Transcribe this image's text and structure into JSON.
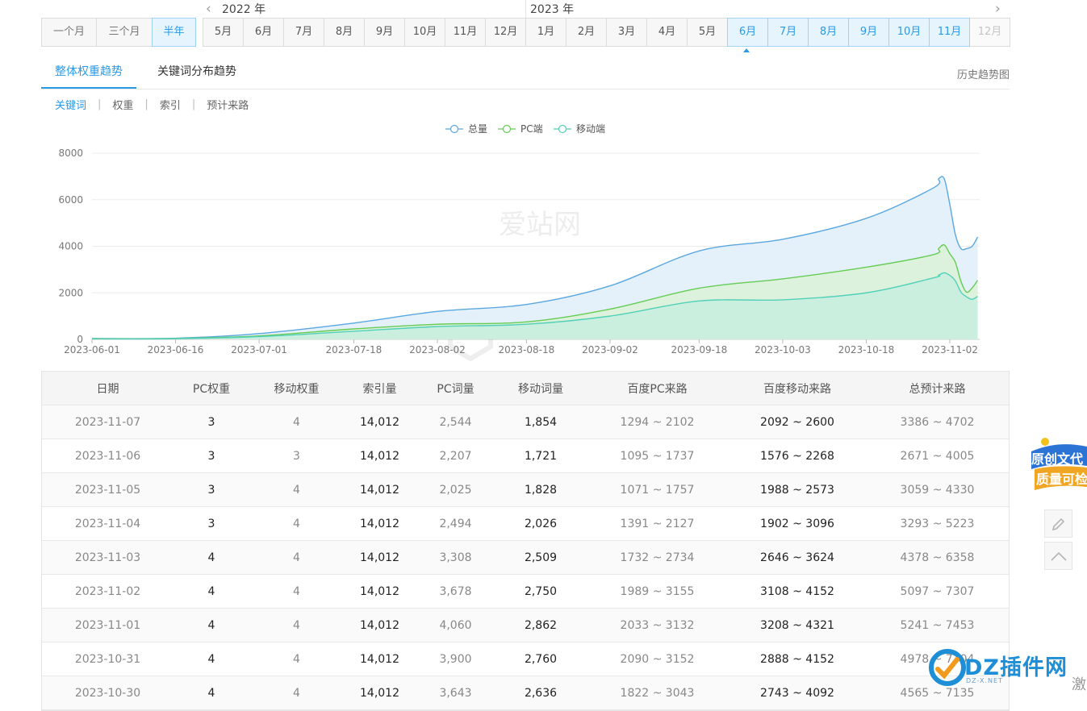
{
  "range_buttons": [
    {
      "label": "一个月",
      "active": false
    },
    {
      "label": "三个月",
      "active": false
    },
    {
      "label": "半年",
      "active": true
    }
  ],
  "timeline": {
    "year_left": "2022 年",
    "year_right": "2023 年",
    "months": [
      {
        "label": "5月",
        "state": "normal"
      },
      {
        "label": "6月",
        "state": "normal"
      },
      {
        "label": "7月",
        "state": "normal"
      },
      {
        "label": "8月",
        "state": "normal"
      },
      {
        "label": "9月",
        "state": "normal"
      },
      {
        "label": "10月",
        "state": "normal"
      },
      {
        "label": "11月",
        "state": "normal"
      },
      {
        "label": "12月",
        "state": "normal"
      },
      {
        "label": "1月",
        "state": "normal"
      },
      {
        "label": "2月",
        "state": "normal"
      },
      {
        "label": "3月",
        "state": "normal"
      },
      {
        "label": "4月",
        "state": "normal"
      },
      {
        "label": "5月",
        "state": "normal"
      },
      {
        "label": "6月",
        "state": "selected"
      },
      {
        "label": "7月",
        "state": "selected"
      },
      {
        "label": "8月",
        "state": "selected"
      },
      {
        "label": "9月",
        "state": "selected"
      },
      {
        "label": "10月",
        "state": "selected"
      },
      {
        "label": "11月",
        "state": "selected"
      },
      {
        "label": "12月",
        "state": "disabled"
      }
    ]
  },
  "tabs": {
    "main": "整体权重趋势",
    "keyword": "关键词分布趋势",
    "history": "历史趋势图"
  },
  "subnav": [
    "关键词",
    "权重",
    "索引",
    "预计来路"
  ],
  "watermark": "爱站网",
  "chart_data": {
    "type": "area",
    "legend_position": "top-center",
    "grid": true,
    "ylim": [
      0,
      8000
    ],
    "yticks": [
      0,
      2000,
      4000,
      6000,
      8000
    ],
    "xticks": [
      "2023-06-01",
      "2023-06-16",
      "2023-07-01",
      "2023-07-18",
      "2023-08-02",
      "2023-08-18",
      "2023-09-02",
      "2023-09-18",
      "2023-10-03",
      "2023-10-18",
      "2023-11-02"
    ],
    "x": [
      "2023-06-01",
      "2023-06-16",
      "2023-07-01",
      "2023-07-18",
      "2023-08-02",
      "2023-08-18",
      "2023-09-02",
      "2023-09-18",
      "2023-10-03",
      "2023-10-18",
      "2023-10-30",
      "2023-10-31",
      "2023-11-01",
      "2023-11-02",
      "2023-11-03",
      "2023-11-04",
      "2023-11-05",
      "2023-11-06",
      "2023-11-07"
    ],
    "series": [
      {
        "name": "总量",
        "color": "#5aa7e0",
        "fill": "#e1f0fb",
        "values": [
          40,
          50,
          250,
          700,
          1200,
          1500,
          2300,
          3800,
          4300,
          5200,
          6500,
          6900,
          6900,
          5800,
          4500,
          3900,
          3900,
          4000,
          4400
        ]
      },
      {
        "name": "PC端",
        "color": "#66cc55",
        "fill": "#dcf2d8",
        "values": [
          30,
          40,
          150,
          450,
          650,
          750,
          1300,
          2200,
          2600,
          3100,
          3640,
          3900,
          4060,
          3680,
          3310,
          2490,
          2030,
          2210,
          2540
        ]
      },
      {
        "name": "移动端",
        "color": "#52d0b8",
        "fill": "#c8eedf",
        "values": [
          20,
          30,
          120,
          350,
          550,
          650,
          1000,
          1650,
          1700,
          2000,
          2640,
          2760,
          2860,
          2750,
          2510,
          2030,
          1830,
          1720,
          1850
        ]
      }
    ]
  },
  "table": {
    "headers": [
      "日期",
      "PC权重",
      "移动权重",
      "索引量",
      "PC词量",
      "移动词量",
      "百度PC来路",
      "百度移动来路",
      "总预计来路"
    ],
    "rows": [
      [
        "2023-11-07",
        "3",
        "4",
        "14,012",
        "2,544",
        "1,854",
        "1294 ~ 2102",
        "2092 ~ 2600",
        "3386 ~ 4702"
      ],
      [
        "2023-11-06",
        "3",
        "3",
        "14,012",
        "2,207",
        "1,721",
        "1095 ~ 1737",
        "1576 ~ 2268",
        "2671 ~ 4005"
      ],
      [
        "2023-11-05",
        "3",
        "4",
        "14,012",
        "2,025",
        "1,828",
        "1071 ~ 1757",
        "1988 ~ 2573",
        "3059 ~ 4330"
      ],
      [
        "2023-11-04",
        "3",
        "4",
        "14,012",
        "2,494",
        "2,026",
        "1391 ~ 2127",
        "1902 ~ 3096",
        "3293 ~ 5223"
      ],
      [
        "2023-11-03",
        "4",
        "4",
        "14,012",
        "3,308",
        "2,509",
        "1732 ~ 2734",
        "2646 ~ 3624",
        "4378 ~ 6358"
      ],
      [
        "2023-11-02",
        "4",
        "4",
        "14,012",
        "3,678",
        "2,750",
        "1989 ~ 3155",
        "3108 ~ 4152",
        "5097 ~ 7307"
      ],
      [
        "2023-11-01",
        "4",
        "4",
        "14,012",
        "4,060",
        "2,862",
        "2033 ~ 3132",
        "3208 ~ 4321",
        "5241 ~ 7453"
      ],
      [
        "2023-10-31",
        "4",
        "4",
        "14,012",
        "3,900",
        "2,760",
        "2090 ~ 3152",
        "2888 ~ 4152",
        "4978 ~ 7304"
      ],
      [
        "2023-10-30",
        "4",
        "4",
        "14,012",
        "3,643",
        "2,636",
        "1822 ~ 3043",
        "2743 ~ 4092",
        "4565 ~ 7135"
      ]
    ]
  },
  "side": {
    "badge_line1": "原创文代",
    "badge_line2": "质量可检",
    "edit_icon": "pencil-icon",
    "top_icon": "chevron-up-icon"
  },
  "brand": {
    "logo_text": "DZ插件网",
    "logo_sub": "DZ-X.NET",
    "edge_char": "激"
  },
  "colors": {
    "accent": "#2a9ae6",
    "selected_bg": "#e6f4fd"
  }
}
